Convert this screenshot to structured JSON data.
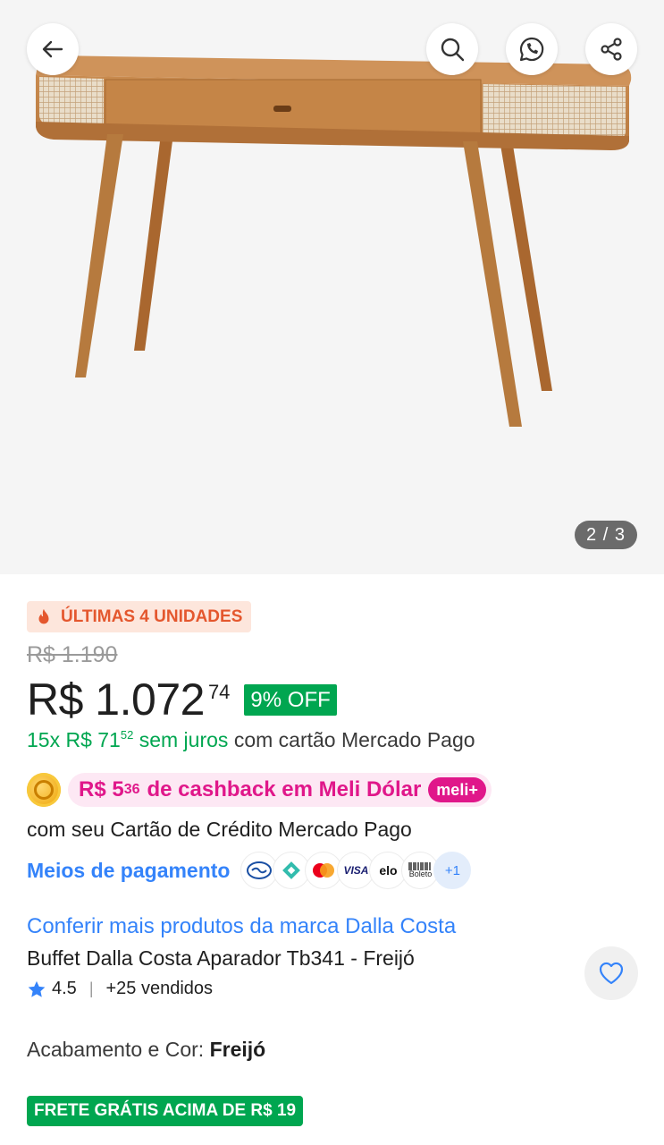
{
  "gallery": {
    "counter": "2 / 3",
    "image_alt": "Buffet Dalla Costa Aparador Tb341 - Freijó"
  },
  "urgency": {
    "label": "ÚLTIMAS 4 UNIDADES",
    "icon": "flame-icon",
    "color": "#e4572e"
  },
  "price": {
    "original": "R$ 1.190",
    "main": "R$ 1.072",
    "cents": "74",
    "discount": "9% OFF"
  },
  "installments": {
    "prefix": "15x R$ 71",
    "cents": "52",
    "no_interest": "sem juros",
    "suffix": "com cartão Mercado Pago"
  },
  "cashback": {
    "amount": "R$ 5",
    "amount_cents": "36",
    "text": "de cashback em Meli Dólar",
    "badge": "meli+",
    "subtitle": "com seu Cartão de Crédito Mercado Pago"
  },
  "payment": {
    "link_label": "Meios de pagamento",
    "methods": [
      "mercado-pago-icon",
      "pix-icon",
      "mastercard-icon",
      "VISA",
      "elo",
      "Boleto"
    ],
    "more": "+1"
  },
  "product": {
    "brand_link": "Conferir mais produtos da marca Dalla Costa",
    "title": "Buffet Dalla Costa Aparador Tb341 - Freijó",
    "rating": "4.5",
    "sold": "+25 vendidos"
  },
  "variant": {
    "label": "Acabamento e Cor:",
    "value": "Freijó"
  },
  "shipping": {
    "label": "FRETE GRÁTIS ACIMA DE R$ 19"
  },
  "colors": {
    "accent_blue": "#3483fa",
    "green": "#00a650",
    "pink": "#e0178a"
  }
}
